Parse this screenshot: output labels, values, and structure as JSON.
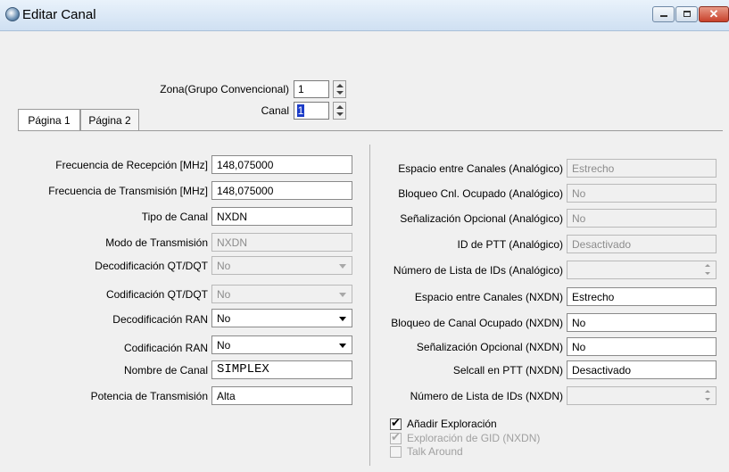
{
  "window": {
    "title": "Editar Canal"
  },
  "header": {
    "zona_label": "Zona(Grupo Convencional)",
    "zona_value": "1",
    "canal_label": "Canal",
    "canal_value": "1"
  },
  "tabs": [
    {
      "label": "Página 1",
      "active": true
    },
    {
      "label": "Página 2",
      "active": false
    }
  ],
  "left": [
    {
      "label": "Frecuencia de Recepción [MHz]",
      "value": "148,075000",
      "kind": "text",
      "enabled": true
    },
    {
      "label": "Frecuencia de Transmisión [MHz]",
      "value": "148,075000",
      "kind": "text",
      "enabled": true
    },
    {
      "label": "Tipo de Canal",
      "value": "NXDN",
      "kind": "text",
      "enabled": true
    },
    {
      "label": "Modo de Transmisión",
      "value": "NXDN",
      "kind": "text",
      "enabled": false
    },
    {
      "label": "Decodificación QT/DQT",
      "value": "No",
      "kind": "combo",
      "enabled": false
    },
    {
      "label": "Codificación QT/DQT",
      "value": "No",
      "kind": "combo",
      "enabled": false
    },
    {
      "label": "Decodificación RAN",
      "value": "No",
      "kind": "combo",
      "enabled": true
    },
    {
      "label": "Codificación RAN",
      "value": "No",
      "kind": "combo",
      "enabled": true
    },
    {
      "label": "Nombre de Canal",
      "value": "SIMPLEX",
      "kind": "text",
      "enabled": true
    },
    {
      "label": "Potencia de Transmisión",
      "value": "Alta",
      "kind": "text",
      "enabled": true
    }
  ],
  "right": [
    {
      "label": "Espacio entre Canales (Analógico)",
      "value": "Estrecho",
      "kind": "text",
      "enabled": false
    },
    {
      "label": "Bloqueo Cnl. Ocupado (Analógico)",
      "value": "No",
      "kind": "text",
      "enabled": false
    },
    {
      "label": "Señalización Opcional (Analógico)",
      "value": "No",
      "kind": "text",
      "enabled": false
    },
    {
      "label": "ID de PTT (Analógico)",
      "value": "Desactivado",
      "kind": "text",
      "enabled": false
    },
    {
      "label": "Número de Lista de IDs (Analógico)",
      "value": "",
      "kind": "spin",
      "enabled": false
    },
    {
      "label": "Espacio entre Canales (NXDN)",
      "value": "Estrecho",
      "kind": "text",
      "enabled": true
    },
    {
      "label": "Bloqueo de Canal Ocupado (NXDN)",
      "value": "No",
      "kind": "text",
      "enabled": true
    },
    {
      "label": "Señalización Opcional (NXDN)",
      "value": "No",
      "kind": "text",
      "enabled": true
    },
    {
      "label": "Selcall en PTT (NXDN)",
      "value": "Desactivado",
      "kind": "text",
      "enabled": true
    },
    {
      "label": "Número de Lista de IDs (NXDN)",
      "value": "",
      "kind": "spin",
      "enabled": false
    }
  ],
  "checkboxes": [
    {
      "label": "Añadir Exploración",
      "checked": true,
      "enabled": true
    },
    {
      "label": "Exploración de GID (NXDN)",
      "checked": true,
      "enabled": false
    },
    {
      "label": "Talk Around",
      "checked": false,
      "enabled": false
    }
  ],
  "icons": {
    "app": "radio-app-icon",
    "minimize": "minimize-icon",
    "maximize": "maximize-icon",
    "close": "close-icon"
  },
  "colors": {
    "titlebar": "#cfe0f2",
    "close_button": "#c8412b",
    "selection": "#1c3cc8",
    "window_bg": "#f0f0f0"
  }
}
